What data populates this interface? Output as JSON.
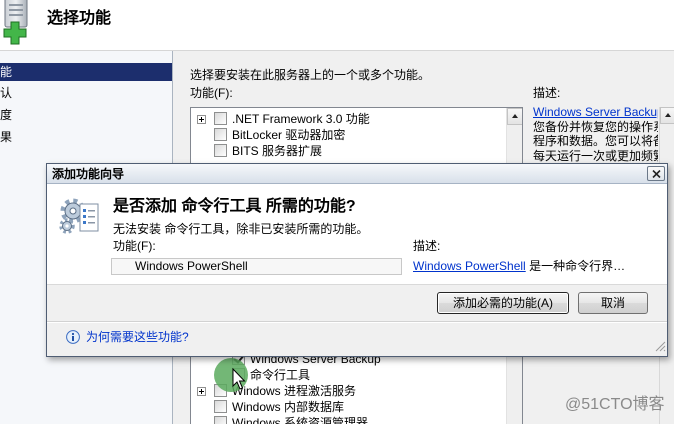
{
  "header": {
    "title": "选择功能",
    "icon": "add-features-server-icon"
  },
  "sidebar": {
    "items": [
      {
        "label": "能",
        "selected": true
      },
      {
        "label": "认",
        "selected": false
      },
      {
        "label": "度",
        "selected": false
      },
      {
        "label": "果",
        "selected": false
      }
    ]
  },
  "main": {
    "instruction": "选择要安装在此服务器上的一个或多个功能。",
    "features_label": "功能(F):",
    "description_label": "描述:",
    "features": [
      {
        "label": ".NET Framework 3.0 功能",
        "checked": false,
        "expandable": true,
        "level": 0
      },
      {
        "label": "BitLocker 驱动器加密",
        "checked": false,
        "expandable": false,
        "level": 0
      },
      {
        "label": "BITS 服务器扩展",
        "checked": false,
        "expandable": false,
        "level": 0
      },
      {
        "label": "Windows Server Backup",
        "checked": true,
        "expandable": false,
        "level": 1
      },
      {
        "label": "命令行工具",
        "checked": false,
        "expandable": false,
        "level": 1
      },
      {
        "label": "Windows 进程激活服务",
        "checked": false,
        "expandable": true,
        "level": 0
      },
      {
        "label": "Windows 内部数据库",
        "checked": false,
        "expandable": false,
        "level": 0
      },
      {
        "label": "Windows 系统资源管理器",
        "checked": false,
        "expandable": false,
        "level": 0
      }
    ],
    "description": {
      "link": "Windows Server Backup I",
      "lines": [
        "您备份并恢复您的操作系统",
        "程序和数据。您可以将备份",
        "每天运行一次或更加频繁，"
      ]
    }
  },
  "dialog": {
    "title": "添加功能向导",
    "heading": "是否添加 命令行工具 所需的功能?",
    "subtext": "无法安装 命令行工具，除非已安装所需的功能。",
    "features_label": "功能(F):",
    "required_features": [
      "Windows PowerShell"
    ],
    "description_label": "描述:",
    "description_link": "Windows PowerShell",
    "description_text": "是一种命令行界…",
    "add_button": "添加必需的功能(A)",
    "cancel_button": "取消",
    "help_link": "为何需要这些功能?"
  },
  "icons": {
    "dialog": "features-gear-icon",
    "close": "close-icon",
    "help": "info-icon",
    "grip": "resize-grip-icon",
    "cursor": "mouse-pointer-icon"
  },
  "watermark": "@51CTO博客",
  "colors": {
    "nav_selected": "#1c2e6d",
    "link": "#0033cc",
    "cursor_highlight": "#5aaa5e"
  }
}
